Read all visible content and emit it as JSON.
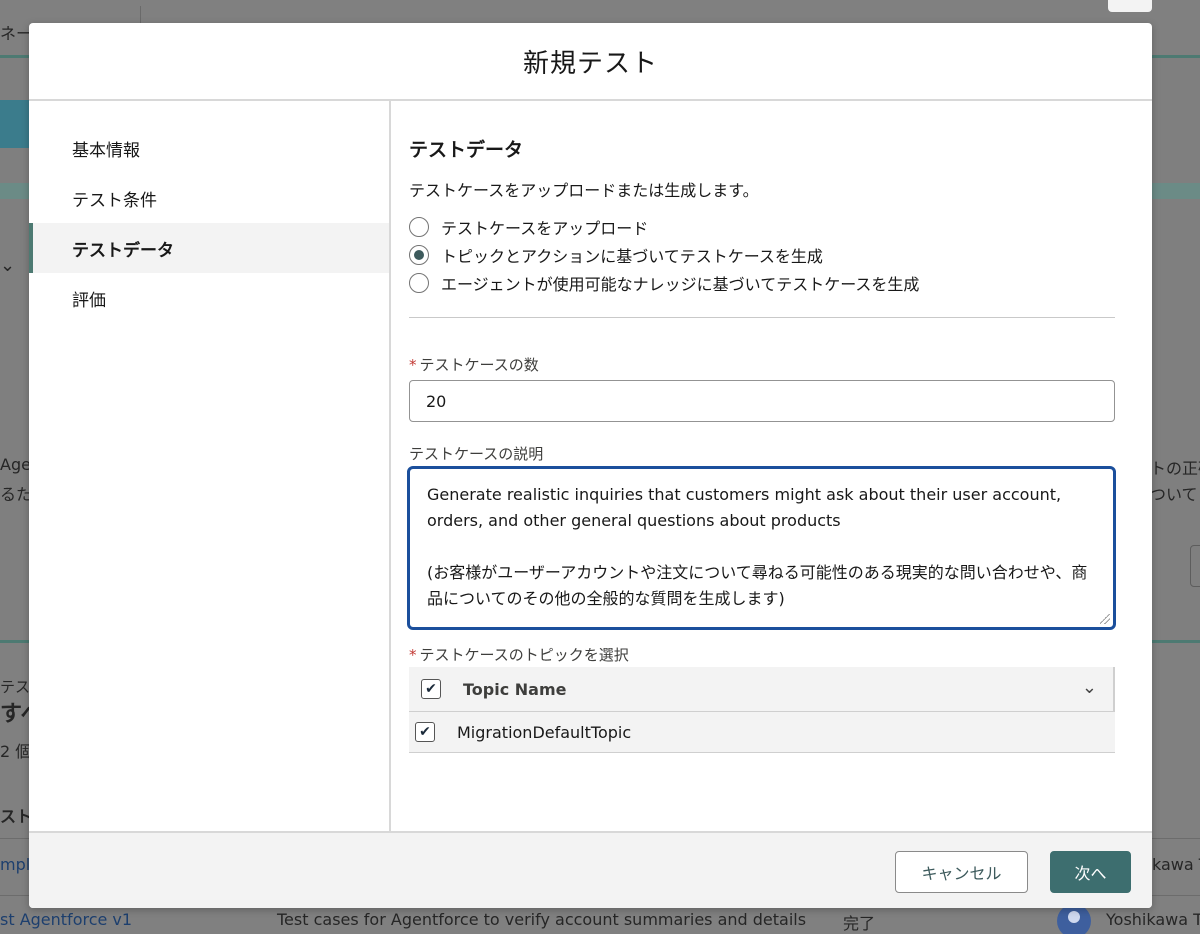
{
  "background": {
    "topbar_fragment": "ネー",
    "left_fragments": [
      "Agen",
      "るた",
      "テス",
      "すへ",
      "2 個",
      "スト",
      "mpla",
      "st Agentforce v1"
    ],
    "right_fragments": [
      "トの正確",
      "ついて"
    ],
    "row_description": "Test cases for Agentforce to verify account summaries and details",
    "row_status": "完了",
    "owner_fragment_1": "kawa T",
    "owner_fragment_2": "Yoshikawa T"
  },
  "modal": {
    "title": "新規テスト",
    "nav": [
      {
        "label": "基本情報",
        "active": false
      },
      {
        "label": "テスト条件",
        "active": false
      },
      {
        "label": "テストデータ",
        "active": true
      },
      {
        "label": "評価",
        "active": false
      }
    ],
    "section": {
      "heading": "テストデータ",
      "description": "テストケースをアップロードまたは生成します。",
      "radios": [
        {
          "label": "テストケースをアップロード",
          "checked": false
        },
        {
          "label": "トピックとアクションに基づいてテストケースを生成",
          "checked": true
        },
        {
          "label": "エージェントが使用可能なナレッジに基づいてテストケースを生成",
          "checked": false
        }
      ]
    },
    "count_field": {
      "required_mark": "*",
      "label": "テストケースの数",
      "value": "20"
    },
    "description_field": {
      "label": "テストケースの説明",
      "value": "Generate realistic inquiries that customers might ask about their user account, orders, and other general questions about products\n\n(お客様がユーザーアカウントや注文について尋ねる可能性のある現実的な問い合わせや、商品についてのその他の全般的な質問を生成します)"
    },
    "topic_field": {
      "required_mark": "*",
      "label": "テストケースのトピックを選択",
      "column_header": "Topic Name",
      "rows": [
        {
          "name": "MigrationDefaultTopic",
          "checked": true
        }
      ]
    },
    "footer": {
      "cancel_label": "キャンセル",
      "next_label": "次へ"
    }
  }
}
